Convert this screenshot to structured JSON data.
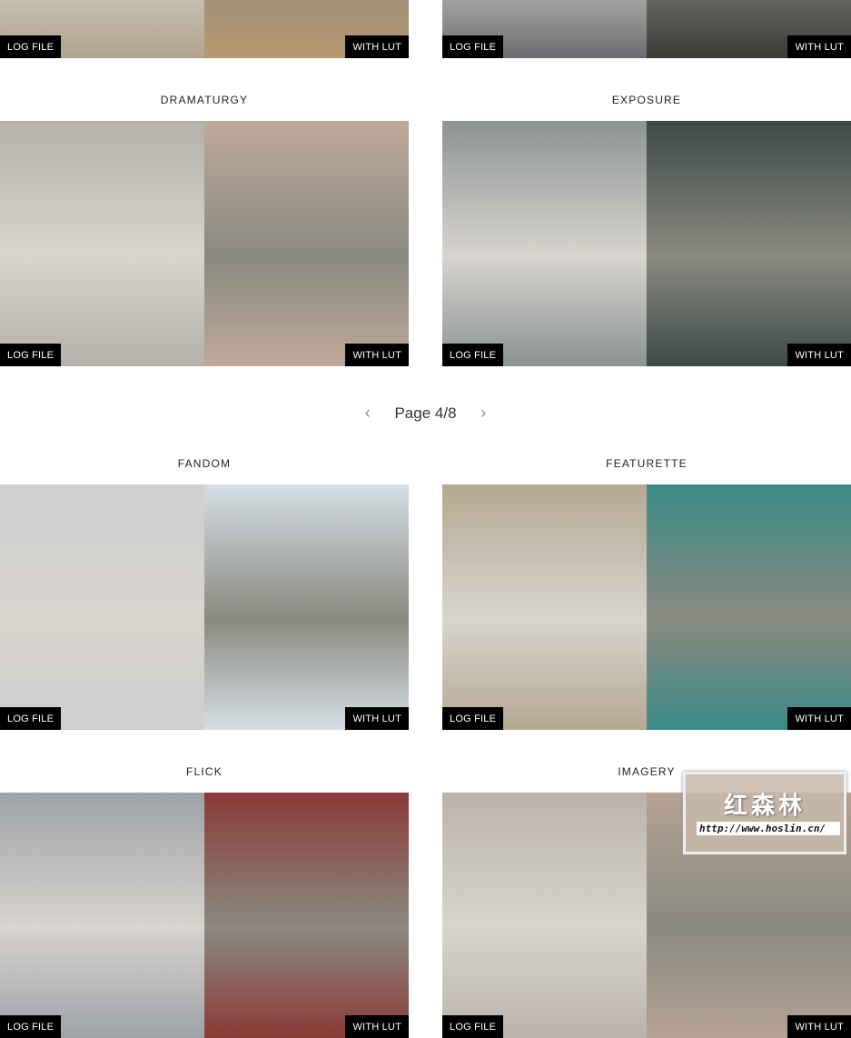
{
  "tags": {
    "log": "LOG FILE",
    "lut": "WITH LUT"
  },
  "pagination": {
    "label": "Page 4/8",
    "prev_icon": "chevron-left-icon",
    "next_icon": "chevron-right-icon"
  },
  "cards": [
    {
      "title": "",
      "colors": [
        "#b0a48c",
        "#b89870"
      ]
    },
    {
      "title": "",
      "colors": [
        "#6c6c70",
        "#3a3a38"
      ]
    },
    {
      "title": "Dramaturgy",
      "colors": [
        "#b4b0aa",
        "#bfa998"
      ]
    },
    {
      "title": "Exposure",
      "colors": [
        "#8c9494",
        "#3d4a48"
      ]
    },
    {
      "title": "Fandom",
      "colors": [
        "#cfcfd0",
        "#d6dfe6"
      ]
    },
    {
      "title": "Featurette",
      "colors": [
        "#b4a890",
        "#3a8a86"
      ]
    },
    {
      "title": "Flick",
      "colors": [
        "#9ea2a8",
        "#8a3a36"
      ]
    },
    {
      "title": "Imagery",
      "colors": [
        "#bab3aa",
        "#b5a293"
      ]
    }
  ],
  "watermark": {
    "name": "红森林",
    "url": "http://www.hoslin.cn/"
  }
}
